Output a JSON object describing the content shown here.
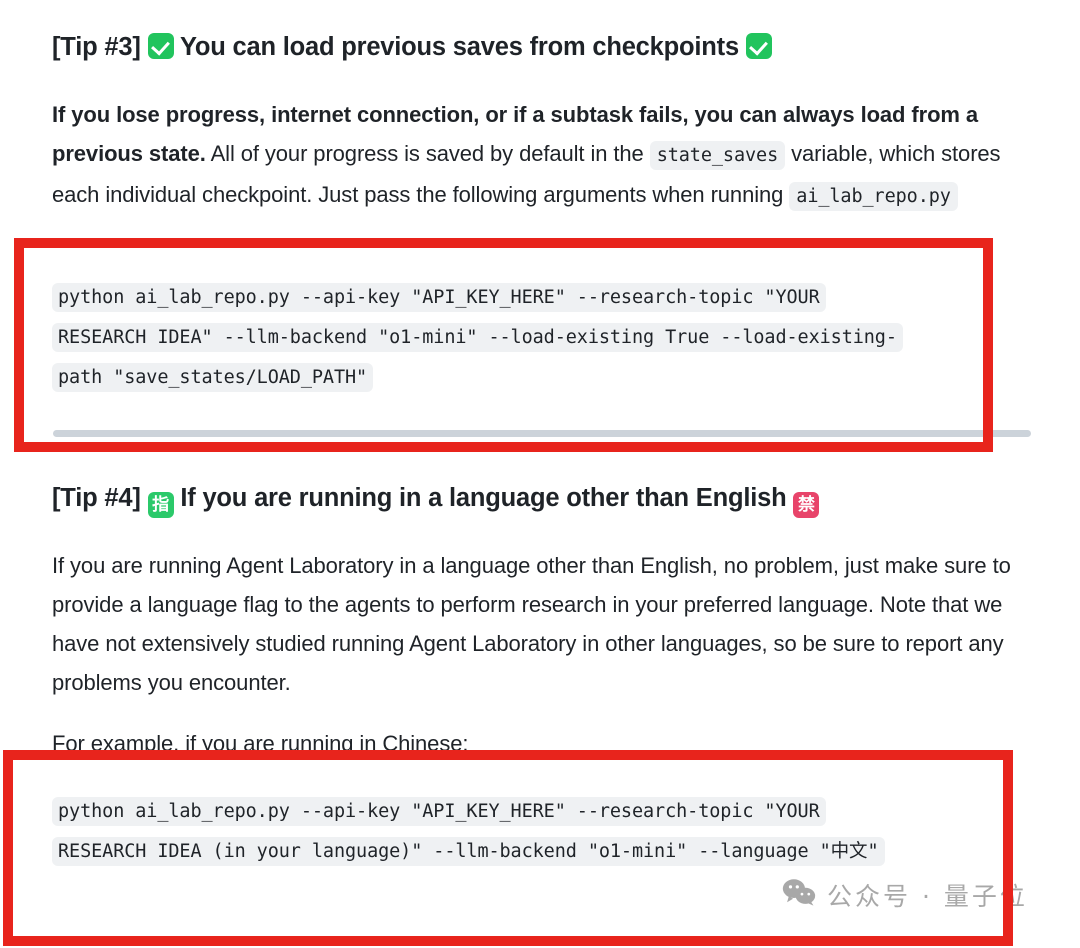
{
  "document": {
    "tip3": {
      "label": "[Tip #3]",
      "icon_left": "white-check-mark-icon",
      "icon_left_glyph": "✅",
      "title": "You can load previous saves from checkpoints",
      "icon_right": "white-check-mark-icon",
      "icon_right_glyph": "✅",
      "paragraph": {
        "bold_part": "If you lose progress, internet connection, or if a subtask fails, you can always load from a previous state.",
        "rest_1": " All of your progress is saved by default in the ",
        "inline_code_1": "state_saves",
        "rest_2": " variable, which stores each individual checkpoint. Just pass the following arguments when running ",
        "inline_code_2": "ai_lab_repo.py"
      },
      "code": {
        "line1": "python ai_lab_repo.py --api-key \"API_KEY_HERE\" --research-topic \"YOUR",
        "line2": "RESEARCH IDEA\" --llm-backend \"o1-mini\" --load-existing True --load-existing-",
        "line3": "path \"save_states/LOAD_PATH\""
      }
    },
    "tip4": {
      "label": "[Tip #4]",
      "icon_left": "japanese-reserved-button-icon",
      "icon_left_glyph": "指",
      "title": "If you are running in a language other than English",
      "icon_right": "japanese-prohibited-button-icon",
      "icon_right_glyph": "禁",
      "paragraph": "If you are running Agent Laboratory in a language other than English, no problem, just make sure to provide a language flag to the agents to perform research in your preferred language. Note that we have not extensively studied running Agent Laboratory in other languages, so be sure to report any problems you encounter.",
      "example_lead": "For example, if you are running in Chinese:",
      "code": {
        "line1": "python ai_lab_repo.py --api-key \"API_KEY_HERE\" --research-topic \"YOUR",
        "line2": "RESEARCH IDEA (in your language)\" --llm-backend \"o1-mini\" --language \"中文\""
      }
    }
  },
  "annotations": {
    "box1_name": "red-highlight-box-tip3-command",
    "box2_name": "red-highlight-box-tip4-command",
    "box_color": "#e8241c"
  },
  "watermark": {
    "icon": "wechat-icon",
    "text": "公众号 · 量子位",
    "color": "#9a9a9a"
  },
  "colors": {
    "code_bg": "#eff1f3",
    "text": "#1f2328",
    "green_badge": "#21c45d",
    "red_badge": "#e8446a",
    "scrollbar": "#ccd3da"
  }
}
